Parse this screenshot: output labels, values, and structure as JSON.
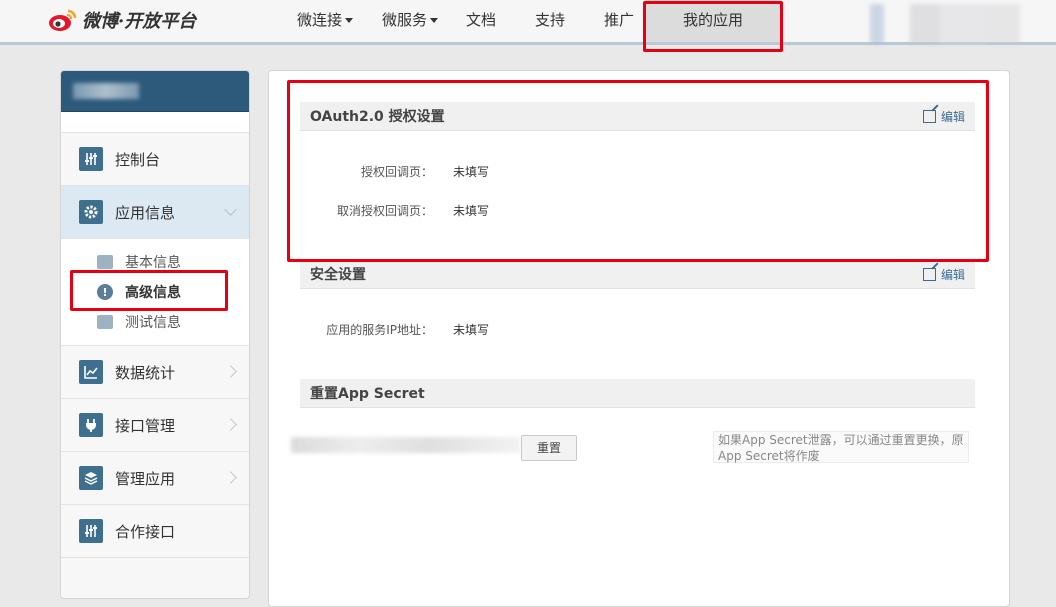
{
  "brand": {
    "logo_text": "微博·开放平台"
  },
  "nav": {
    "items": [
      {
        "label": "微连接",
        "dropdown": true
      },
      {
        "label": "微服务",
        "dropdown": true
      },
      {
        "label": "文档",
        "dropdown": false
      },
      {
        "label": "支持",
        "dropdown": false
      },
      {
        "label": "推广",
        "dropdown": false
      },
      {
        "label": "我的应用",
        "dropdown": false,
        "active": true
      }
    ]
  },
  "sidebar": {
    "items": [
      {
        "label": "控制台",
        "icon": "sliders-icon"
      },
      {
        "label": "应用信息",
        "icon": "gear-icon",
        "active": true
      },
      {
        "label": "数据统计",
        "icon": "chart-icon"
      },
      {
        "label": "接口管理",
        "icon": "plug-icon"
      },
      {
        "label": "管理应用",
        "icon": "layers-icon"
      },
      {
        "label": "合作接口",
        "icon": "sliders-icon"
      }
    ],
    "sub_items": [
      {
        "label": "基本信息",
        "icon": "card-icon"
      },
      {
        "label": "高级信息",
        "icon": "info-icon",
        "active": true
      },
      {
        "label": "测试信息",
        "icon": "user-card-icon"
      }
    ]
  },
  "oauth": {
    "title": "OAuth2.0 授权设置",
    "edit_label": "编辑",
    "callback_label": "授权回调页：",
    "callback_value": "未填写",
    "cancel_callback_label": "取消授权回调页：",
    "cancel_callback_value": "未填写"
  },
  "security": {
    "title": "安全设置",
    "edit_label": "编辑",
    "ip_label": "应用的服务IP地址：",
    "ip_value": "未填写"
  },
  "secret": {
    "title": "重置App Secret",
    "reset_label": "重置",
    "hint": "如果App Secret泄露，可以通过重置更换，原App Secret将作废"
  },
  "colors": {
    "highlight": "#e60012",
    "sidebar_header": "#2d5a7b",
    "icon": "#3f6f8f",
    "link": "#3b6a93",
    "active_item": "#dce9f3"
  }
}
